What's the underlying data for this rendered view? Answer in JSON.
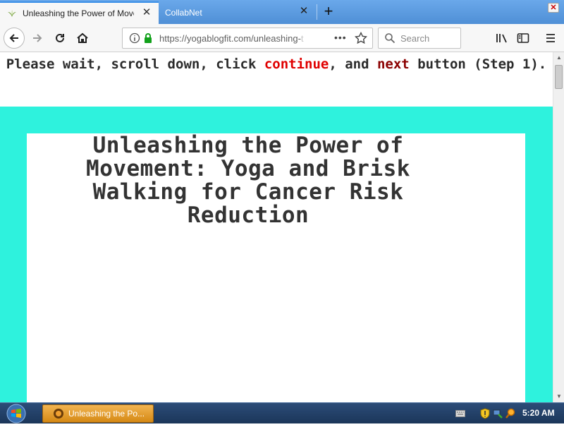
{
  "browser": {
    "tabs": [
      {
        "title": "Unleashing the Power of Movem",
        "active": true
      },
      {
        "title": "CollabNet",
        "active": false
      }
    ],
    "address_url": "https://yogablogfit.com/unleashing-",
    "address_url_fade": "t",
    "search_placeholder": "Search"
  },
  "page": {
    "notice_part1": "Please wait, scroll down, click ",
    "notice_continue": "continue",
    "notice_part2": ", and ",
    "notice_next": "next",
    "notice_part3": " button (Step 1).",
    "headline": "Unleashing the Power of Movement: Yoga and Brisk Walking for Cancer Risk Reduction"
  },
  "taskbar": {
    "task_label": "Unleashing the Po...",
    "clock": "5:20 AM"
  },
  "colors": {
    "teal_background": "#2ef2dd",
    "notice_red": "#e00000",
    "notice_darkred": "#8b0000",
    "taskbar_button": "#e09c2c"
  }
}
